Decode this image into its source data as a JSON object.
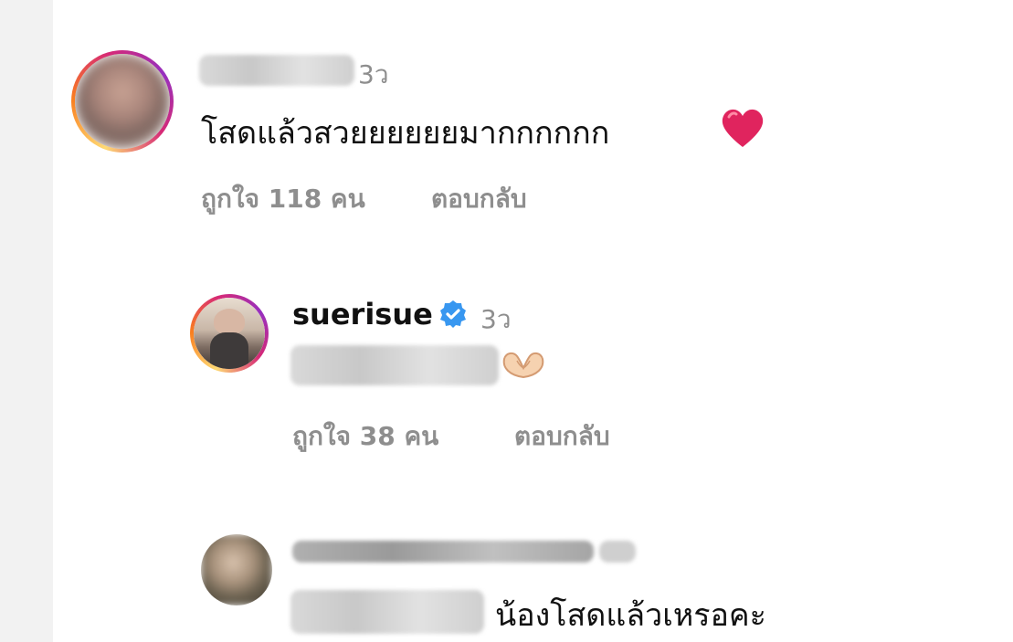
{
  "comments": [
    {
      "time": "3ว",
      "text": "โสดแล้วสวยยยยยยมากกกกกก",
      "likes": "ถูกใจ 118 คน",
      "reply": "ตอบกลับ",
      "icon": "heart-emoji"
    },
    {
      "username": "suerisue",
      "verified_icon": "verified-badge-icon",
      "time": "3ว",
      "likes": "ถูกใจ 38 คน",
      "reply": "ตอบกลับ",
      "icon": "heart-hands-emoji"
    },
    {
      "text": "น้องโสดแล้วเหรอคะ"
    }
  ],
  "colors": {
    "meta": "#8e8e8e",
    "verified": "#3897f0",
    "heart": "#e0245e"
  }
}
